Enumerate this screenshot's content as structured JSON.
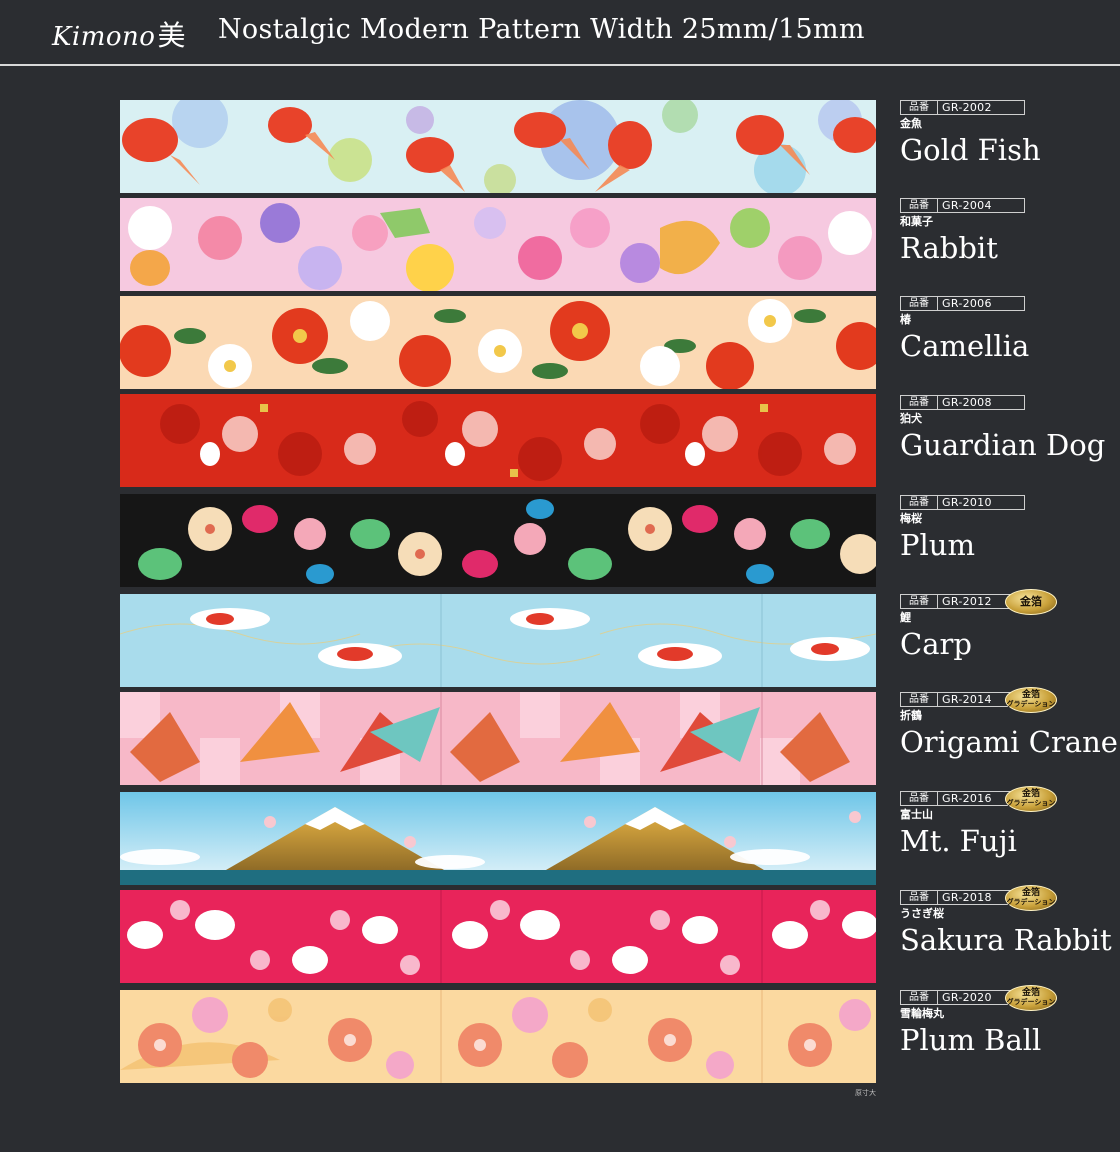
{
  "header": {
    "logo_text": "Kimono",
    "logo_kanji": "美",
    "title": "Nostalgic Modern Pattern  Width 25mm/15mm"
  },
  "label_prefix": "品番",
  "footer_note": "原寸大",
  "colors": {
    "background": "#2b2d31",
    "rule": "#d8d8d8",
    "gold": "#c9a13a"
  },
  "products": [
    {
      "code": "GR-2002",
      "jp": "金魚",
      "en": "Gold Fish"
    },
    {
      "code": "GR-2004",
      "jp": "和菓子",
      "en": "Rabbit"
    },
    {
      "code": "GR-2006",
      "jp": "椿",
      "en": "Camellia"
    },
    {
      "code": "GR-2008",
      "jp": "狛犬",
      "en": "Guardian Dog"
    },
    {
      "code": "GR-2010",
      "jp": "梅桜",
      "en": "Plum"
    },
    {
      "code": "GR-2012",
      "jp": "鯉",
      "en": "Carp",
      "badge": "金箔"
    },
    {
      "code": "GR-2014",
      "jp": "折鶴",
      "en": "Origami Crane",
      "badge_line1": "金箔",
      "badge_line2": "グラデーション"
    },
    {
      "code": "GR-2016",
      "jp": "富士山",
      "en": "Mt. Fuji",
      "badge_line1": "金箔",
      "badge_line2": "グラデーション"
    },
    {
      "code": "GR-2018",
      "jp": "うさぎ桜",
      "en": "Sakura Rabbit",
      "badge_line1": "金箔",
      "badge_line2": "グラデーション"
    },
    {
      "code": "GR-2020",
      "jp": "雪輪梅丸",
      "en": "Plum Ball",
      "badge_line1": "金箔",
      "badge_line2": "グラデーション"
    }
  ]
}
